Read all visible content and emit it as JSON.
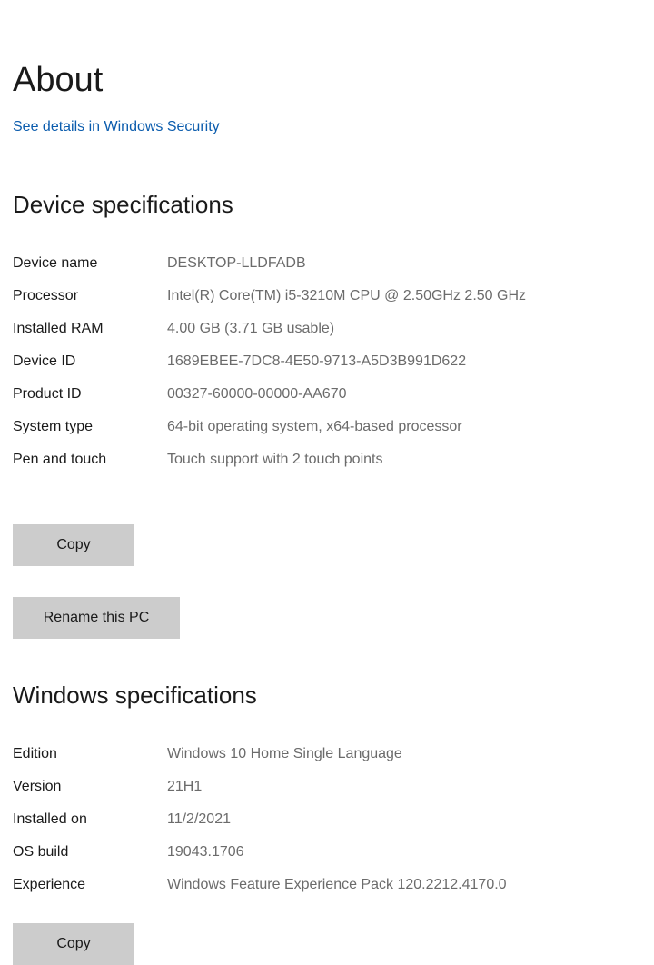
{
  "header": {
    "title": "About",
    "security_link": "See details in Windows Security"
  },
  "device_specs": {
    "heading": "Device specifications",
    "rows": [
      {
        "label": "Device name",
        "value": "DESKTOP-LLDFADB"
      },
      {
        "label": "Processor",
        "value": "Intel(R) Core(TM) i5-3210M CPU @ 2.50GHz   2.50 GHz"
      },
      {
        "label": "Installed RAM",
        "value": "4.00 GB (3.71 GB usable)"
      },
      {
        "label": "Device ID",
        "value": "1689EBEE-7DC8-4E50-9713-A5D3B991D622"
      },
      {
        "label": "Product ID",
        "value": "00327-60000-00000-AA670"
      },
      {
        "label": "System type",
        "value": "64-bit operating system, x64-based processor"
      },
      {
        "label": "Pen and touch",
        "value": "Touch support with 2 touch points"
      }
    ],
    "copy_label": "Copy",
    "rename_label": "Rename this PC"
  },
  "windows_specs": {
    "heading": "Windows specifications",
    "rows": [
      {
        "label": "Edition",
        "value": "Windows 10 Home Single Language"
      },
      {
        "label": "Version",
        "value": "21H1"
      },
      {
        "label": "Installed on",
        "value": "11/2/2021"
      },
      {
        "label": "OS build",
        "value": "19043.1706"
      },
      {
        "label": "Experience",
        "value": "Windows Feature Experience Pack 120.2212.4170.0"
      }
    ],
    "copy_label": "Copy"
  },
  "colors": {
    "link": "#0b5cad",
    "button_bg": "#cccccc",
    "value_text": "#6b6b6b"
  }
}
